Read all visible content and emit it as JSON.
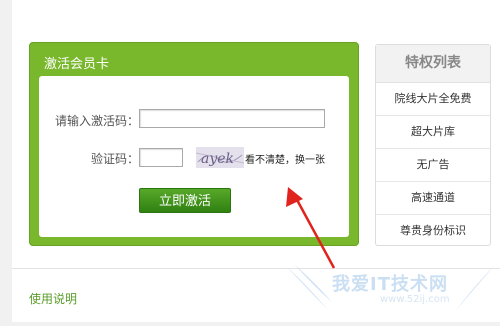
{
  "card": {
    "title": "激活会员卡",
    "code_label": "请输入激活码：",
    "code_value": "",
    "verify_label": "验证码：",
    "verify_value": "",
    "captcha_text": "ayek",
    "refresh_text": "看不清楚，换一张",
    "activate_button": "立即激活"
  },
  "privileges": {
    "title": "特权列表",
    "items": [
      "院线大片全免费",
      "超大片库",
      "无广告",
      "高速通道",
      "尊贵身份标识"
    ]
  },
  "footer": {
    "usage_link": "使用说明"
  },
  "watermark": {
    "text": "我爱IT技术网",
    "url": "www.52ij.com"
  },
  "colors": {
    "card_green": "#79b72c",
    "button_green": "#3f9219",
    "arrow_red": "#e0231c",
    "link_green": "#5a9d2a"
  }
}
